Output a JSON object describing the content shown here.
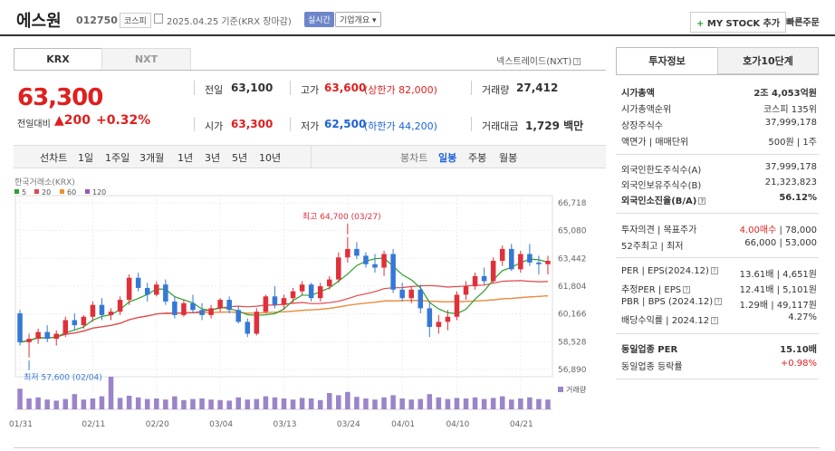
{
  "header": {
    "name": "에스원",
    "code": "012750",
    "market": "코스피",
    "date": "2025.04.25 기준(KRX 장마감)",
    "realtime": "실시간",
    "overview": "기업개요 ▾",
    "mystock": "MY STOCK 추가",
    "mystock_plus": "+",
    "quick_order": "빠른주문"
  },
  "tabs": {
    "krx": "KRX",
    "nxt": "NXT",
    "nxt_link": "넥스트레이드(NXT)"
  },
  "price": {
    "current": "63,300",
    "diff_label": "전일대비",
    "diff_value": "▲200",
    "diff_rate": "+0.32%"
  },
  "stats": {
    "prev_label": "전일",
    "prev": "63,100",
    "high_label": "고가",
    "high": "63,600",
    "high_limit": "(상한가 82,000)",
    "volume_label": "거래량",
    "volume": "27,412",
    "open_label": "시가",
    "open": "63,300",
    "low_label": "저가",
    "low": "62,500",
    "low_limit": "(하한가 44,200)",
    "amount_label": "거래대금",
    "amount": "1,729 백만"
  },
  "period": {
    "line_label": "선차트",
    "line_items": [
      "1일",
      "1주일",
      "3개월",
      "1년",
      "3년",
      "5년",
      "10년"
    ],
    "candle_label": "봉차트",
    "candle_items": [
      "일봉",
      "주봉",
      "월봉"
    ],
    "active": "일봉"
  },
  "chart_data": {
    "type": "candlestick",
    "source": "한국거래소(KRX)",
    "legend": [
      "5",
      "20",
      "60",
      "120"
    ],
    "legend_colors": [
      "#2ca02c",
      "#e0474c",
      "#f0902c",
      "#9b59b6"
    ],
    "y_ticks": [
      "66,718",
      "65,080",
      "63,442",
      "61,804",
      "60,166",
      "58,528",
      "56,890"
    ],
    "ylim": [
      56890,
      66718
    ],
    "x_ticks": [
      "01/31",
      "02/11",
      "02/20",
      "03/04",
      "03/13",
      "03/24",
      "04/01",
      "04/10",
      "04/21"
    ],
    "max_label": "최고 64,700 (03/27)",
    "min_label": "최저 57,600 (02/04)",
    "volume_label": "거래량",
    "candles": [
      [
        60200,
        60400,
        58300,
        58500
      ],
      [
        58500,
        59000,
        57600,
        58700
      ],
      [
        58700,
        59300,
        58400,
        59100
      ],
      [
        59100,
        59500,
        58500,
        58700
      ],
      [
        58700,
        59200,
        58300,
        59000
      ],
      [
        59000,
        60000,
        58800,
        59800
      ],
      [
        59800,
        60200,
        59200,
        59500
      ],
      [
        59500,
        60100,
        59300,
        60000
      ],
      [
        60000,
        60900,
        59700,
        60700
      ],
      [
        60700,
        61100,
        59800,
        60100
      ],
      [
        60100,
        60500,
        59800,
        60300
      ],
      [
        60300,
        61200,
        60100,
        61000
      ],
      [
        61000,
        62500,
        60700,
        62300
      ],
      [
        62300,
        62600,
        61500,
        61700
      ],
      [
        61700,
        62000,
        60900,
        61300
      ],
      [
        61300,
        62100,
        61200,
        61900
      ],
      [
        61900,
        62200,
        60700,
        60900
      ],
      [
        60900,
        61200,
        59900,
        60100
      ],
      [
        60100,
        61000,
        60000,
        60800
      ],
      [
        60800,
        61300,
        60200,
        60400
      ],
      [
        60400,
        60800,
        59800,
        60100
      ],
      [
        60100,
        60700,
        59900,
        60500
      ],
      [
        60500,
        61100,
        60300,
        61000
      ],
      [
        61000,
        61200,
        60200,
        60400
      ],
      [
        60400,
        60600,
        59600,
        59700
      ],
      [
        59700,
        59900,
        58800,
        59000
      ],
      [
        59000,
        60500,
        58900,
        60300
      ],
      [
        60300,
        61300,
        60200,
        61200
      ],
      [
        61200,
        61800,
        60500,
        60700
      ],
      [
        60700,
        61300,
        60400,
        61100
      ],
      [
        61100,
        61700,
        60800,
        61500
      ],
      [
        61500,
        62100,
        61300,
        61900
      ],
      [
        61900,
        62000,
        60900,
        61100
      ],
      [
        61100,
        62000,
        60900,
        61800
      ],
      [
        61800,
        62400,
        61600,
        62200
      ],
      [
        62200,
        63800,
        62000,
        63500
      ],
      [
        63500,
        64700,
        63200,
        64000
      ],
      [
        64000,
        64400,
        63400,
        63600
      ],
      [
        63600,
        63800,
        62900,
        63100
      ],
      [
        63100,
        63700,
        62600,
        62900
      ],
      [
        62900,
        63900,
        62400,
        63700
      ],
      [
        63700,
        64000,
        61400,
        61600
      ],
      [
        61600,
        62000,
        60900,
        61100
      ],
      [
        61100,
        61800,
        60800,
        61600
      ],
      [
        61600,
        61900,
        60200,
        60500
      ],
      [
        60500,
        60900,
        58800,
        59400
      ],
      [
        59400,
        60100,
        59000,
        59700
      ],
      [
        59700,
        60400,
        59200,
        60000
      ],
      [
        60000,
        61500,
        59800,
        61300
      ],
      [
        61300,
        62100,
        61000,
        61800
      ],
      [
        61800,
        62600,
        61600,
        62400
      ],
      [
        62400,
        62900,
        61900,
        62100
      ],
      [
        62100,
        63500,
        62000,
        63300
      ],
      [
        63300,
        64200,
        63000,
        64000
      ],
      [
        64000,
        64300,
        62700,
        62800
      ],
      [
        62800,
        63900,
        62600,
        63700
      ],
      [
        63700,
        64300,
        63000,
        63200
      ],
      [
        63200,
        63600,
        62500,
        63100
      ],
      [
        63100,
        63600,
        62500,
        63300
      ]
    ],
    "volumes": [
      38,
      20,
      22,
      18,
      16,
      19,
      28,
      18,
      20,
      24,
      60,
      21,
      25,
      22,
      19,
      20,
      18,
      24,
      17,
      19,
      20,
      18,
      17,
      16,
      22,
      18,
      19,
      24,
      22,
      20,
      18,
      21,
      20,
      17,
      30,
      26,
      32,
      23,
      20,
      18,
      22,
      26,
      20,
      18,
      19,
      28,
      22,
      19,
      21,
      20,
      22,
      19,
      21,
      24,
      18,
      20,
      22,
      19,
      18
    ]
  },
  "right_panel": {
    "tab_info": "투자정보",
    "tab_ask": "호가10단계",
    "rows1": [
      {
        "k": "시가총액",
        "v": "2조 4,053억원"
      },
      {
        "k": "시가총액순위",
        "v": "코스피 135위"
      },
      {
        "k": "상장주식수",
        "v": "37,999,178"
      },
      {
        "k": "액면가 | 매매단위",
        "v": "500원 | 1주"
      }
    ],
    "rows2": [
      {
        "k": "외국인한도주식수(A)",
        "v": "37,999,178"
      },
      {
        "k": "외국인보유주식수(B)",
        "v": "21,323,823"
      },
      {
        "k": "외국인소진율(B/A)",
        "v": "56.12%"
      }
    ],
    "rows3": [
      {
        "k": "투자의견 | 목표주가",
        "v1": "4.00매수",
        "v2": " | 78,000"
      },
      {
        "k": "52주최고 | 최저",
        "v": "66,000 | 53,000"
      }
    ],
    "rows4": [
      {
        "k": "PER | EPS(2024.12)",
        "v": "13.61배 | 4,651원"
      },
      {
        "k": "추정PER | EPS",
        "v": "12.41배 | 5,101원"
      },
      {
        "k": "PBR | BPS (2024.12)",
        "v": "1.29배 | 49,117원"
      },
      {
        "k": "배당수익률 | 2024.12",
        "v": "4.27%"
      }
    ],
    "rows5": [
      {
        "k": "동일업종 PER",
        "v": "15.10배"
      },
      {
        "k": "동일업종 등락률",
        "v": "+0.98%"
      }
    ]
  }
}
